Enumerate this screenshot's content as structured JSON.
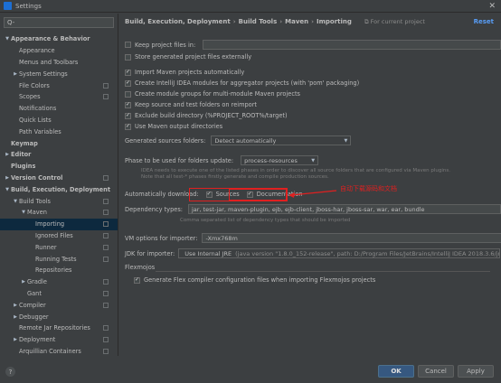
{
  "window": {
    "title": "Settings"
  },
  "search": {
    "placeholder": "Q-"
  },
  "sidebar": {
    "items": [
      {
        "label": "Appearance & Behavior",
        "level": 0,
        "arrow": "▼",
        "bold": true
      },
      {
        "label": "Appearance",
        "level": 1
      },
      {
        "label": "Menus and Toolbars",
        "level": 1
      },
      {
        "label": "System Settings",
        "level": 1,
        "arrow": "▶"
      },
      {
        "label": "File Colors",
        "level": 1,
        "badge": true
      },
      {
        "label": "Scopes",
        "level": 1,
        "badge": true
      },
      {
        "label": "Notifications",
        "level": 1
      },
      {
        "label": "Quick Lists",
        "level": 1
      },
      {
        "label": "Path Variables",
        "level": 1
      },
      {
        "label": "Keymap",
        "level": 0,
        "bold": true
      },
      {
        "label": "Editor",
        "level": 0,
        "arrow": "▶",
        "bold": true
      },
      {
        "label": "Plugins",
        "level": 0,
        "bold": true
      },
      {
        "label": "Version Control",
        "level": 0,
        "arrow": "▶",
        "bold": true,
        "badge": true
      },
      {
        "label": "Build, Execution, Deployment",
        "level": 0,
        "arrow": "▼",
        "bold": true
      },
      {
        "label": "Build Tools",
        "level": 1,
        "arrow": "▼",
        "badge": true
      },
      {
        "label": "Maven",
        "level": 2,
        "arrow": "▼",
        "badge": true
      },
      {
        "label": "Importing",
        "level": 3,
        "badge": true,
        "selected": true
      },
      {
        "label": "Ignored Files",
        "level": 3,
        "badge": true
      },
      {
        "label": "Runner",
        "level": 3,
        "badge": true
      },
      {
        "label": "Running Tests",
        "level": 3,
        "badge": true
      },
      {
        "label": "Repositories",
        "level": 3
      },
      {
        "label": "Gradle",
        "level": 2,
        "arrow": "▶",
        "badge": true
      },
      {
        "label": "Gant",
        "level": 2,
        "badge": true
      },
      {
        "label": "Compiler",
        "level": 1,
        "arrow": "▶",
        "badge": true
      },
      {
        "label": "Debugger",
        "level": 1,
        "arrow": "▶"
      },
      {
        "label": "Remote Jar Repositories",
        "level": 1,
        "badge": true
      },
      {
        "label": "Deployment",
        "level": 1,
        "arrow": "▶",
        "badge": true
      },
      {
        "label": "Arquillian Containers",
        "level": 1,
        "badge": true
      }
    ]
  },
  "breadcrumb": {
    "parts": [
      "Build, Execution, Deployment",
      "Build Tools",
      "Maven",
      "Importing"
    ],
    "separator": "›",
    "current_project": "For current project",
    "reset": "Reset"
  },
  "options": {
    "keep_project_files": "Keep project files in:",
    "store_generated": "Store generated project files externally",
    "import_auto": "Import Maven projects automatically",
    "create_modules": "Create IntelliJ IDEA modules for aggregator projects (with 'pom' packaging)",
    "create_groups": "Create module groups for multi-module Maven projects",
    "keep_source": "Keep source and test folders on reimport",
    "exclude_build": "Exclude build directory (%PROJECT_ROOT%/target)",
    "use_output": "Use Maven output directories"
  },
  "generated_sources": {
    "label": "Generated sources folders:",
    "value": "Detect automatically"
  },
  "phase": {
    "label": "Phase to be used for folders update:",
    "value": "process-resources",
    "hint1": "IDEA needs to execute one of the listed phases in order to discover all source folders that are configured via Maven plugins.",
    "hint2": "Note that all test-* phases firstly generate and compile production sources."
  },
  "auto_download": {
    "label": "Automatically download:",
    "sources": "Sources",
    "documentation": "Documentation",
    "annotation": "自动下载源码和文档"
  },
  "dependency_types": {
    "label": "Dependency types:",
    "value": "jar, test-jar, maven-plugin, ejb, ejb-client, jboss-har, jboss-sar, war, ear, bundle",
    "hint": "Comma separated list of dependency types that should be imported"
  },
  "vm_options": {
    "label": "VM options for importer:",
    "value": "-Xmx768m"
  },
  "jdk": {
    "label": "JDK for importer:",
    "value": "Use Internal JRE",
    "detail": "(java version \"1.8.0_152-release\", path: D:/Program Files/JetBrains/IntelliJ IDEA 2018.3.6/jre64)"
  },
  "flexmojos": {
    "header": "Flexmojos",
    "generate": "Generate Flex compiler configuration files when importing Flexmojos projects"
  },
  "footer": {
    "help": "?",
    "ok": "OK",
    "cancel": "Cancel",
    "apply": "Apply"
  },
  "colors": {
    "accent": "#589df6",
    "annotation": "#e02020",
    "selection": "#0d293e",
    "ok_button": "#365880"
  }
}
